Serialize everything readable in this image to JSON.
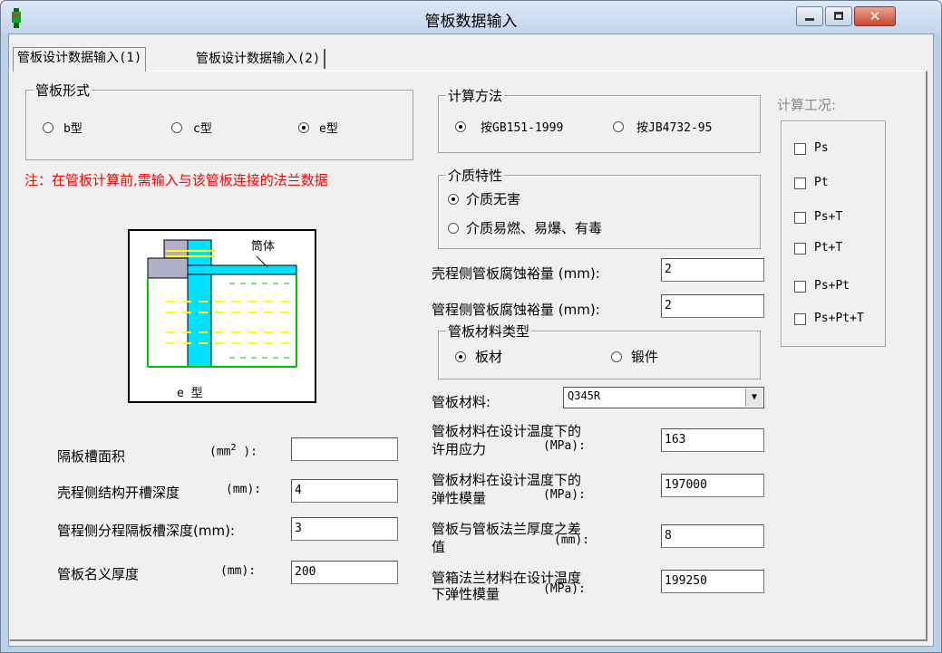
{
  "window": {
    "title": "管板数据输入"
  },
  "tabs": [
    "管板设计数据输入(1)",
    "管板设计数据输入(2)"
  ],
  "tube_sheet_form": {
    "title": "管板形式",
    "options": [
      "b型",
      "c型",
      "e型"
    ],
    "selected": "e型"
  },
  "note": "注：在管板计算前,需输入与该管板连接的法兰数据",
  "diagram": {
    "label_cylinder": "筒体",
    "caption": "e 型"
  },
  "left_fields": {
    "partition_area_label": "隔板槽面积",
    "partition_area_unit": "(mm",
    "partition_area_sup": "2",
    "partition_area_unit_end": " ):",
    "partition_area_value": "",
    "shell_groove_label": "壳程侧结构开槽深度",
    "shell_groove_unit": "(mm):",
    "shell_groove_value": "4",
    "tube_groove_label": "管程侧分程隔板槽深度(mm):",
    "tube_groove_value": "3",
    "nominal_thickness_label": "管板名义厚度",
    "nominal_thickness_unit": "(mm):",
    "nominal_thickness_value": "200"
  },
  "calc_method": {
    "title": "计算方法",
    "options": [
      "按GB151-1999",
      "按JB4732-95"
    ],
    "selected": "按GB151-1999"
  },
  "medium": {
    "title": "介质特性",
    "options": [
      "介质无害",
      "介质易燃、易爆、有毒"
    ],
    "selected": "介质无害"
  },
  "corrosion": {
    "shell_label": "壳程侧管板腐蚀裕量 (mm):",
    "shell_value": "2",
    "tube_label": "管程侧管板腐蚀裕量 (mm):",
    "tube_value": "2"
  },
  "material_type": {
    "title": "管板材料类型",
    "options": [
      "板材",
      "锻件"
    ],
    "selected": "板材"
  },
  "material": {
    "label": "管板材料:",
    "value": "Q345R",
    "allow_stress_label_1": "管板材料在设计温度下的",
    "allow_stress_label_2": "许用应力",
    "allow_stress_unit": "(MPa):",
    "allow_stress_value": "163",
    "modulus_label_1": "管板材料在设计温度下的",
    "modulus_label_2": "弹性模量",
    "modulus_unit": "(MPa):",
    "modulus_value": "197000",
    "thickness_diff_label_1": "管板与管板法兰厚度之差",
    "thickness_diff_label_2": "值",
    "thickness_diff_unit": "(mm):",
    "thickness_diff_value": "8",
    "flange_modulus_label_1": "管箱法兰材料在设计温度",
    "flange_modulus_label_2": "下弹性模量",
    "flange_modulus_unit": "(MPa):",
    "flange_modulus_value": "199250"
  },
  "conditions": {
    "title": "计算工况:",
    "items": [
      "Ps",
      "Pt",
      "Ps+T",
      "Pt+T",
      "Ps+Pt",
      "Ps+Pt+T"
    ]
  }
}
